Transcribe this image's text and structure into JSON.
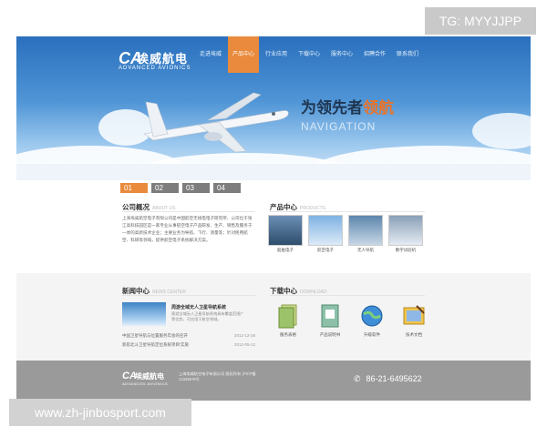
{
  "watermark_tg": "TG: MYYJJPP",
  "watermark_url": "www.zh-jinbosport.com",
  "brand": {
    "mark": "CA",
    "name_cn": "埃威航电",
    "name_en": "ADVANCED AVIONICS"
  },
  "nav": [
    "走进埃威",
    "产品中心",
    "行业应用",
    "下载中心",
    "服务中心",
    "招聘合作",
    "联系我们"
  ],
  "hero": {
    "slogan_part1": "为领先者",
    "slogan_highlight": "领航",
    "slogan_en": "NAVIGATION"
  },
  "slide_tabs": [
    "01",
    "02",
    "03",
    "04"
  ],
  "company": {
    "title": "公司概况",
    "subtitle": "ABOUT US",
    "text": "上海埃威航空电子有限公司是中国航空无线电电子研究所、公司位于张江高科技园区是一家专业从事航空电子产品研发、生产、销售及服务于一体的高新技术企业；主要业务为导航、飞行、测量等；针对民用航空、科研等领域，提供航空电子系统解决方案。"
  },
  "products": {
    "title": "产品中心",
    "subtitle": "PRODUCTS",
    "items": [
      "船舶电子",
      "航空电子",
      "无人导航",
      "数字试验机"
    ]
  },
  "news": {
    "title": "新闻中心",
    "subtitle": "NEWS CENTER",
    "feature_title": "周游全域无人卫星导航系统",
    "feature_desc": "周游全域无人卫星导航系统具有覆盖范围广等优势，可应用于航空领域。",
    "items": [
      {
        "text": "中国卫星导航与位置服务年会的召开",
        "date": "2012-12-28"
      },
      {
        "text": "新航北斗卫星导航定位系统项目'实施",
        "date": "2012-05-12"
      }
    ]
  },
  "downloads": {
    "title": "下载中心",
    "subtitle": "DOWNLOAD",
    "items": [
      "服务表格",
      "产品说明书",
      "升级软件",
      "技术文档"
    ]
  },
  "footer": {
    "logo_cn": "埃威航电",
    "logo_en": "ADVANCED AVIONICS",
    "info": "上海埃威航空电子有限公司 版权所有 沪ICP备12345678号",
    "phone": "86-21-6495622"
  },
  "colors": {
    "accent": "#e98a3c",
    "sky": "#2a6fbd",
    "footer": "#9a9a9a"
  },
  "icons": {
    "phone": "phone-icon"
  }
}
